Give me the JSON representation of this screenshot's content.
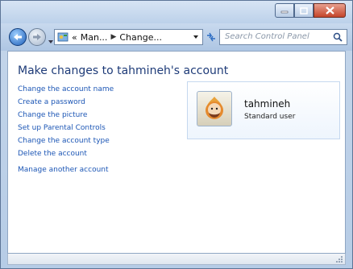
{
  "window": {
    "caption_buttons": {
      "minimize": "minimize-icon",
      "maximize": "maximize-icon",
      "close": "close-icon"
    }
  },
  "nav": {
    "address_prefix": "«",
    "breadcrumb": [
      "Man...",
      "Change..."
    ],
    "search_placeholder": "Search Control Panel"
  },
  "page": {
    "title": "Make changes to tahmineh's account",
    "links": [
      "Change the account name",
      "Create a password",
      "Change the picture",
      "Set up Parental Controls",
      "Change the account type",
      "Delete the account"
    ],
    "manage_other": "Manage another account"
  },
  "account": {
    "name": "tahmineh",
    "type": "Standard user"
  }
}
